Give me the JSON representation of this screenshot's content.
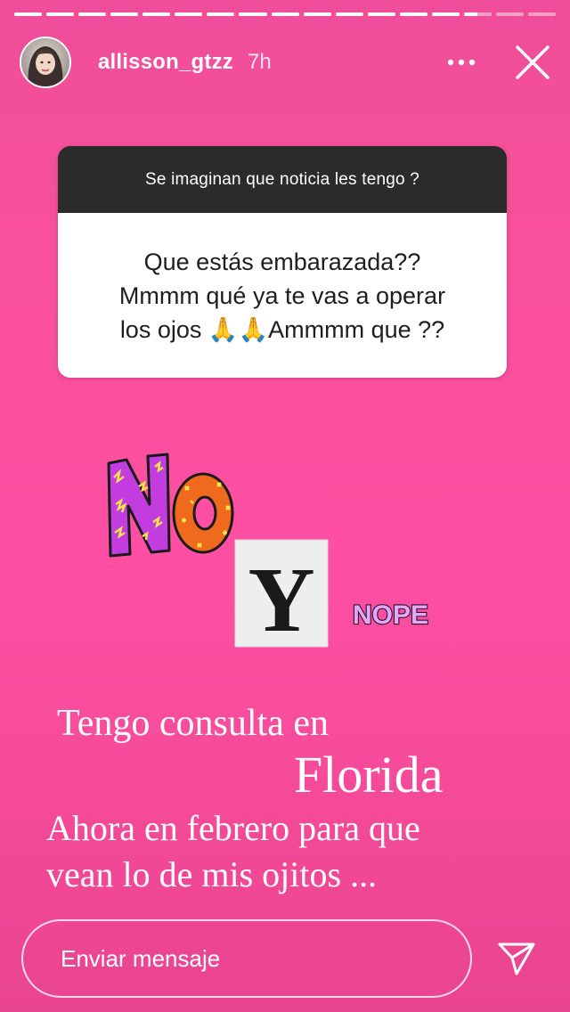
{
  "story": {
    "progress": [
      {
        "fill": 1.0
      },
      {
        "fill": 1.0
      },
      {
        "fill": 1.0
      },
      {
        "fill": 1.0
      },
      {
        "fill": 1.0
      },
      {
        "fill": 1.0
      },
      {
        "fill": 1.0
      },
      {
        "fill": 1.0
      },
      {
        "fill": 1.0
      },
      {
        "fill": 1.0
      },
      {
        "fill": 1.0
      },
      {
        "fill": 1.0
      },
      {
        "fill": 1.0
      },
      {
        "fill": 1.0
      },
      {
        "fill": 0.5
      },
      {
        "fill": 0.0
      },
      {
        "fill": 0.0
      }
    ]
  },
  "header": {
    "username": "allisson_gtzz",
    "time_ago": "7h",
    "avatar_icon": "user-avatar",
    "more_icon": "more-horizontal-icon",
    "close_icon": "close-icon"
  },
  "question": {
    "prompt": "Se imaginan que noticia les tengo ?",
    "answer": "Que estás embarazada??\nMmmm qué ya te vas a operar\nlos ojos 🙏🙏Ammmm que ??"
  },
  "stickers": {
    "no_text": "NO",
    "y_text": "Y",
    "nope_text": "NOPE"
  },
  "caption": {
    "line1": "Tengo consulta en",
    "line2": "Florida",
    "line3": "Ahora en febrero para que",
    "line4": "vean lo de mis ojitos ..."
  },
  "reply": {
    "placeholder": "Enviar mensaje",
    "send_icon": "send-icon"
  },
  "colors": {
    "background": "#ff4fa3",
    "card_header": "#2b2b2b",
    "card_body": "#ffffff",
    "sticker_purple": "#c23ce0",
    "sticker_orange": "#f06a1e"
  }
}
